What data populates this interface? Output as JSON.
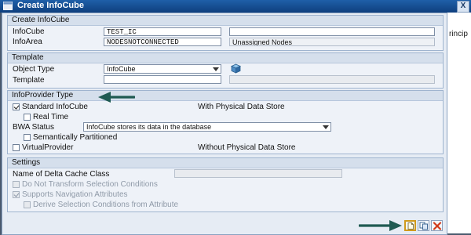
{
  "window": {
    "title": "Create InfoCube",
    "close_glyph": "X"
  },
  "right_strip_text": "rincip",
  "create_infocube": {
    "header": "Create InfoCube",
    "infocube_label": "InfoCube",
    "infocube_value": "TEST_IC",
    "infocube_desc": "",
    "infoarea_label": "InfoArea",
    "infoarea_value": "NODESNOTCONNECTED",
    "infoarea_desc": "Unassigned Nodes"
  },
  "template": {
    "header": "Template",
    "object_type_label": "Object Type",
    "object_type_value": "InfoCube",
    "template_label": "Template",
    "template_value": ""
  },
  "infoprovider_type": {
    "header": "InfoProvider Type",
    "standard_label": "Standard InfoCube",
    "standard_checked": true,
    "with_physical": "With Physical Data Store",
    "real_time_label": "Real Time",
    "real_time_checked": false,
    "bwa_status_label": "BWA Status",
    "bwa_status_value": "InfoCube stores its data in the database",
    "semantic_label": "Semantically Partitioned",
    "semantic_checked": false,
    "virtual_label": "VirtualProvider",
    "virtual_checked": false,
    "without_physical": "Without Physical Data Store"
  },
  "settings": {
    "header": "Settings",
    "delta_cache_label": "Name of Delta Cache Class",
    "delta_cache_value": "",
    "no_transform_label": "Do Not Transform Selection Conditions",
    "no_transform_checked": false,
    "nav_attr_label": "Supports Navigation Attributes",
    "nav_attr_checked": true,
    "derive_label": "Derive Selection Conditions from Attribute",
    "derive_checked": false
  },
  "footer_buttons": [
    {
      "name": "create-button",
      "icon": "new-document-icon"
    },
    {
      "name": "copy-button",
      "icon": "copy-icon"
    },
    {
      "name": "cancel-button",
      "icon": "cancel-x-icon"
    }
  ],
  "colors": {
    "title_bar": "#1f5fa8",
    "dialog_bg": "#e6ecf4",
    "annotation_arrow": "#1f5a52",
    "cancel_red": "#d23a1a"
  }
}
